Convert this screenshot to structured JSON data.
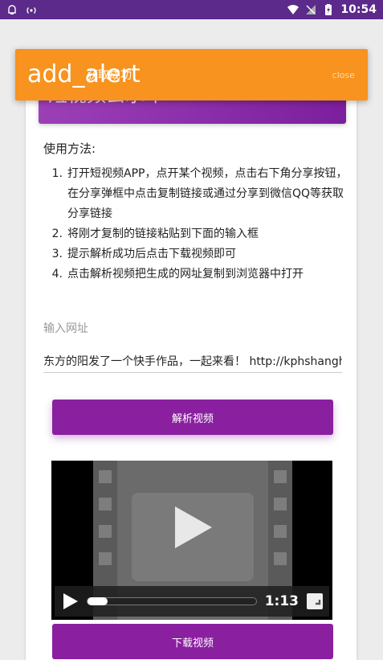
{
  "status_bar": {
    "time": "10:54"
  },
  "header": {
    "title": "短视频去水印"
  },
  "usage": {
    "title": "使用方法:",
    "steps": [
      {
        "num": "1.",
        "text": "打开短视频APP，点开某个视频，点击右下角分享按钮，在分享弹框中点击复制链接或通过分享到微信QQ等获取分享链接"
      },
      {
        "num": "2.",
        "text": "将刚才复制的链接粘贴到下面的输入框"
      },
      {
        "num": "3.",
        "text": "提示解析成功后点击下载视频即可"
      },
      {
        "num": "4.",
        "text": "点击解析视频把生成的网址复制到浏览器中打开"
      }
    ]
  },
  "input": {
    "label": "输入网址",
    "value": "东方的阳发了一个快手作品，一起来看！ http://kphshanghai"
  },
  "buttons": {
    "parse": "解析视频",
    "download": "下载视频"
  },
  "video": {
    "time": "1:13",
    "progress": 0.05
  },
  "alert": {
    "icon_text": "add_alert",
    "message": "获取成功",
    "close": "close"
  },
  "colors": {
    "accent": "#8a1fa0",
    "alert": "#f7931e",
    "status_bar": "#5b2a8a"
  }
}
